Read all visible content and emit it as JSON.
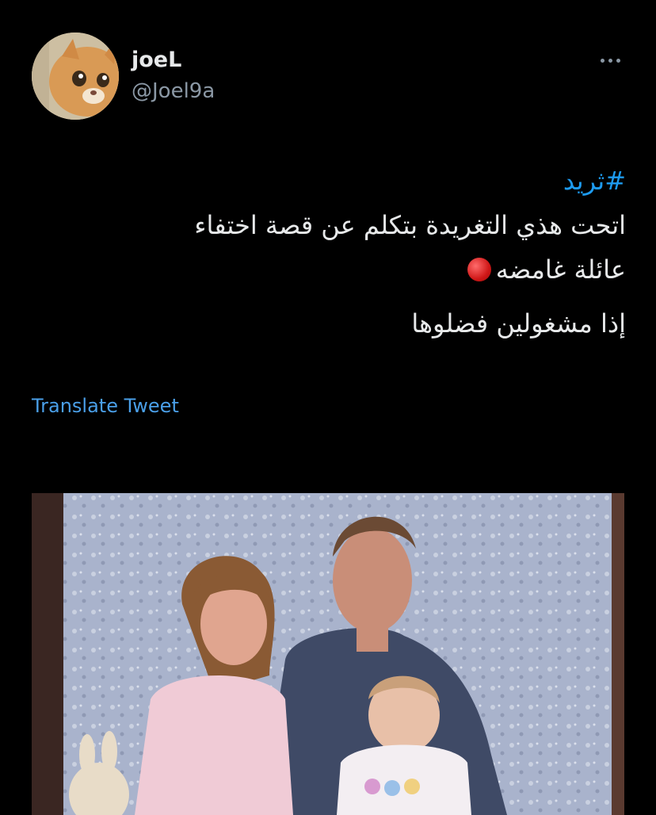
{
  "user": {
    "display_name": "joeL",
    "handle": "@Joel9a",
    "avatar_icon": "cat-avatar-icon"
  },
  "tweet": {
    "hashtag": "#ثريد",
    "line1": "اتحت هذي التغريدة بتكلم عن قصة اختفاء",
    "line2": "عائلة غامضه",
    "line3": "إذا مشغولين فضلوها",
    "emoji": "red-circle-icon"
  },
  "actions": {
    "translate_label": "Translate Tweet"
  },
  "media": {
    "type": "photo"
  },
  "colors": {
    "background": "#000000",
    "text": "#e7e9ea",
    "secondary": "#8b98a5",
    "link": "#1d9bf0"
  }
}
